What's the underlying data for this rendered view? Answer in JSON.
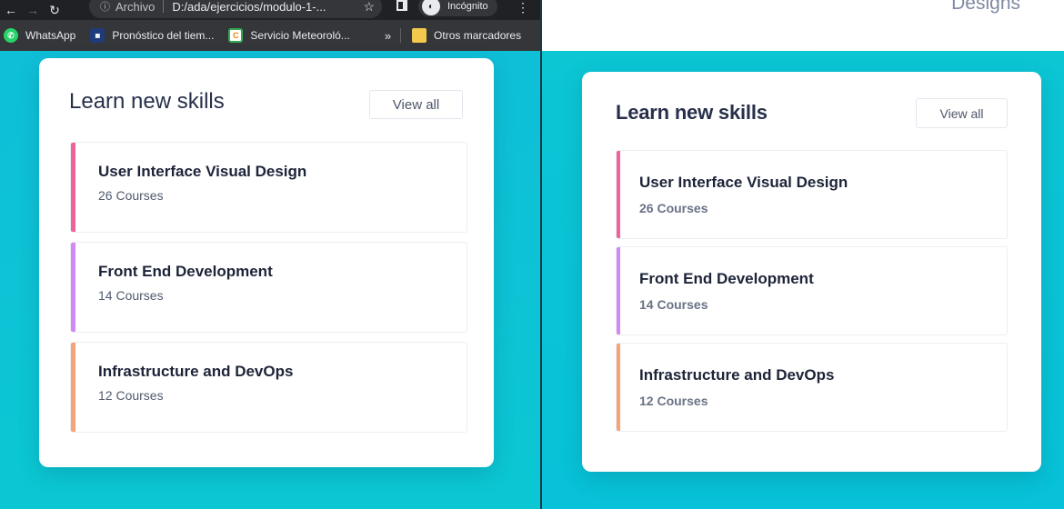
{
  "browser": {
    "omnibox": {
      "info_icon": "info-icon",
      "scheme_label": "Archivo",
      "url": "D:/ada/ejercicios/modulo-1-..."
    },
    "incognito_label": "Incógnito",
    "bookmarks": [
      {
        "label": "WhatsApp",
        "icon": "whatsapp-icon"
      },
      {
        "label": "Pronóstico del tiem...",
        "icon": "weather-channel-icon"
      },
      {
        "label": "Servicio Meteoroló...",
        "icon": "site-favicon-icon"
      }
    ],
    "bookmarks_overflow": "»",
    "other_bookmarks": "Otros marcadores"
  },
  "implementation": {
    "title": "Learn new skills",
    "view_all": "View all",
    "skills": [
      {
        "name": "User Interface Visual Design",
        "count": "26 Courses",
        "color": "#f0629b"
      },
      {
        "name": "Front End Development",
        "count": "14 Courses",
        "color": "#d18af5"
      },
      {
        "name": "Infrastructure and DevOps",
        "count": "12 Courses",
        "color": "#f6a375"
      }
    ]
  },
  "design": {
    "header_text": "Designs",
    "title": "Learn new skills",
    "view_all": "View all",
    "skills": [
      {
        "name": "User Interface Visual Design",
        "count": "26 Courses",
        "color": "#f0629b"
      },
      {
        "name": "Front End Development",
        "count": "14 Courses",
        "color": "#d18af5"
      },
      {
        "name": "Infrastructure and DevOps",
        "count": "12 Courses",
        "color": "#f6a375"
      }
    ]
  },
  "colors": {
    "background": "#0cc2d6",
    "card": "#ffffff",
    "title": "#27304a"
  }
}
